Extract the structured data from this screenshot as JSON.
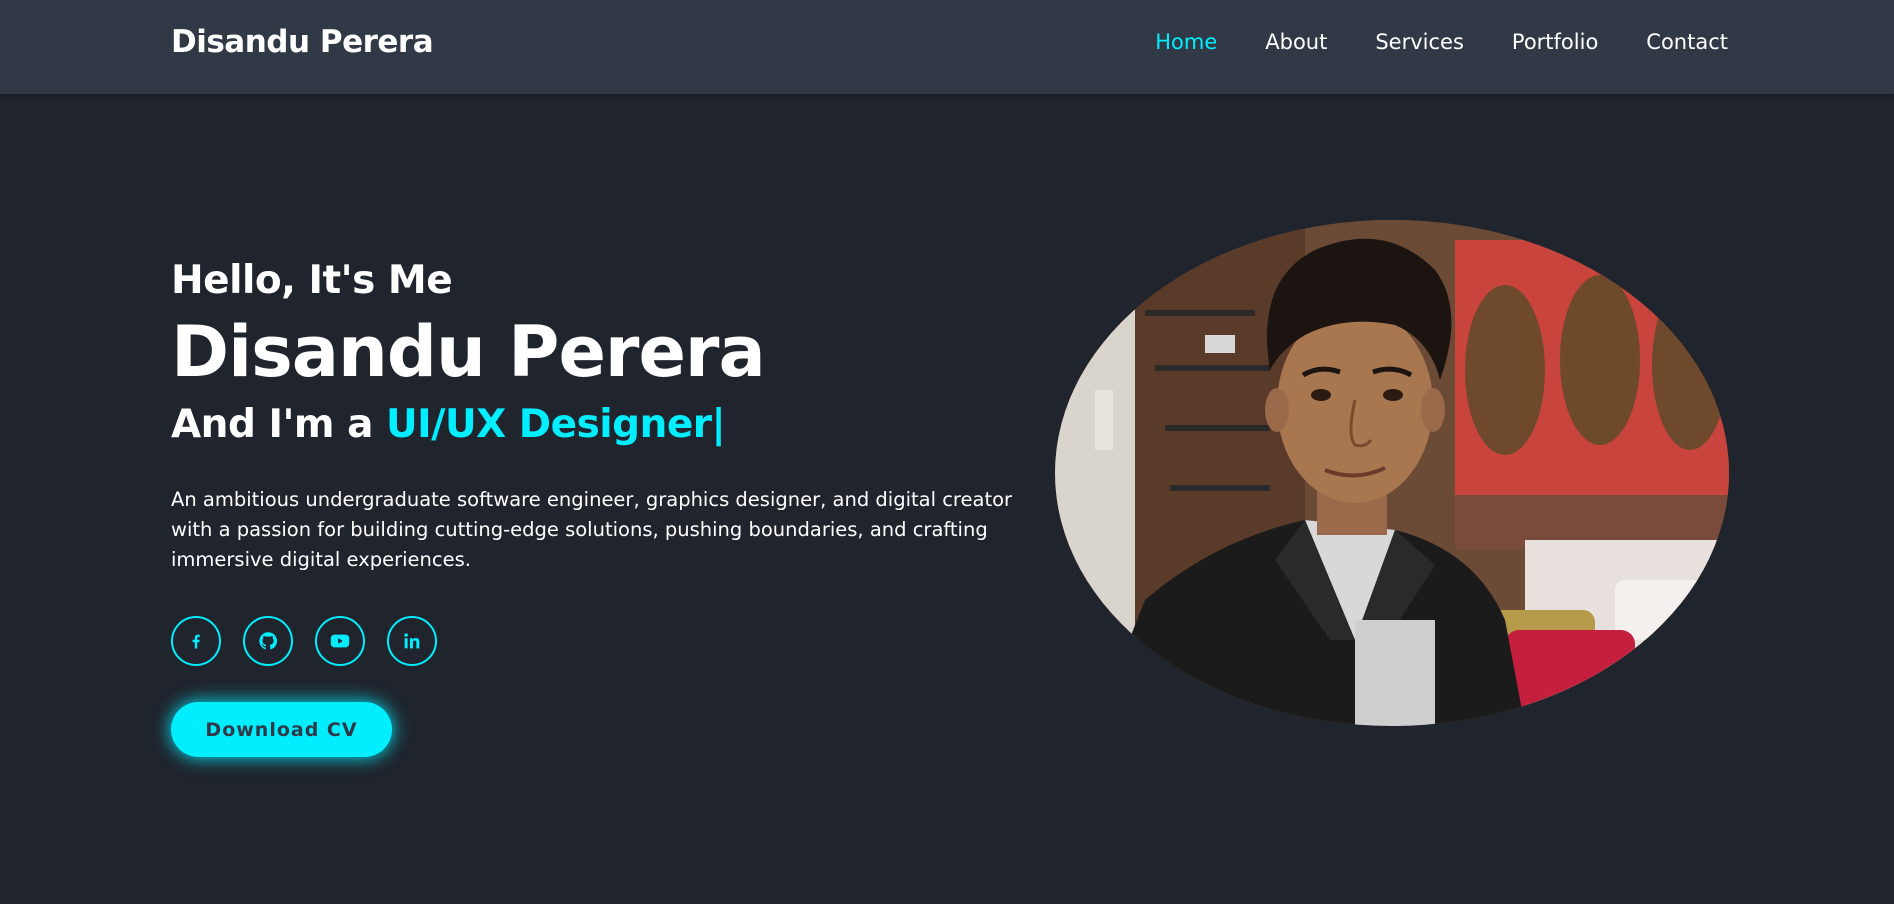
{
  "header": {
    "logo": "Disandu Perera",
    "nav": [
      {
        "label": "Home",
        "active": true
      },
      {
        "label": "About",
        "active": false
      },
      {
        "label": "Services",
        "active": false
      },
      {
        "label": "Portfolio",
        "active": false
      },
      {
        "label": "Contact",
        "active": false
      }
    ]
  },
  "hero": {
    "greeting": "Hello, It's Me",
    "name": "Disandu Perera",
    "role_prefix": "And I'm a ",
    "role_highlight": "UI/UX Designer",
    "role_cursor": "|",
    "description": "An ambitious undergraduate software engineer, graphics designer, and digital creator with a passion for building cutting-edge solutions, pushing boundaries, and crafting immersive digital experiences.",
    "socials": [
      {
        "icon": "facebook-icon"
      },
      {
        "icon": "github-icon"
      },
      {
        "icon": "youtube-icon"
      },
      {
        "icon": "linkedin-icon"
      }
    ],
    "cv_button": "Download CV"
  },
  "colors": {
    "background": "#1f242d",
    "header_background": "#323946",
    "accent": "#00eeff",
    "text": "#ffffff"
  }
}
